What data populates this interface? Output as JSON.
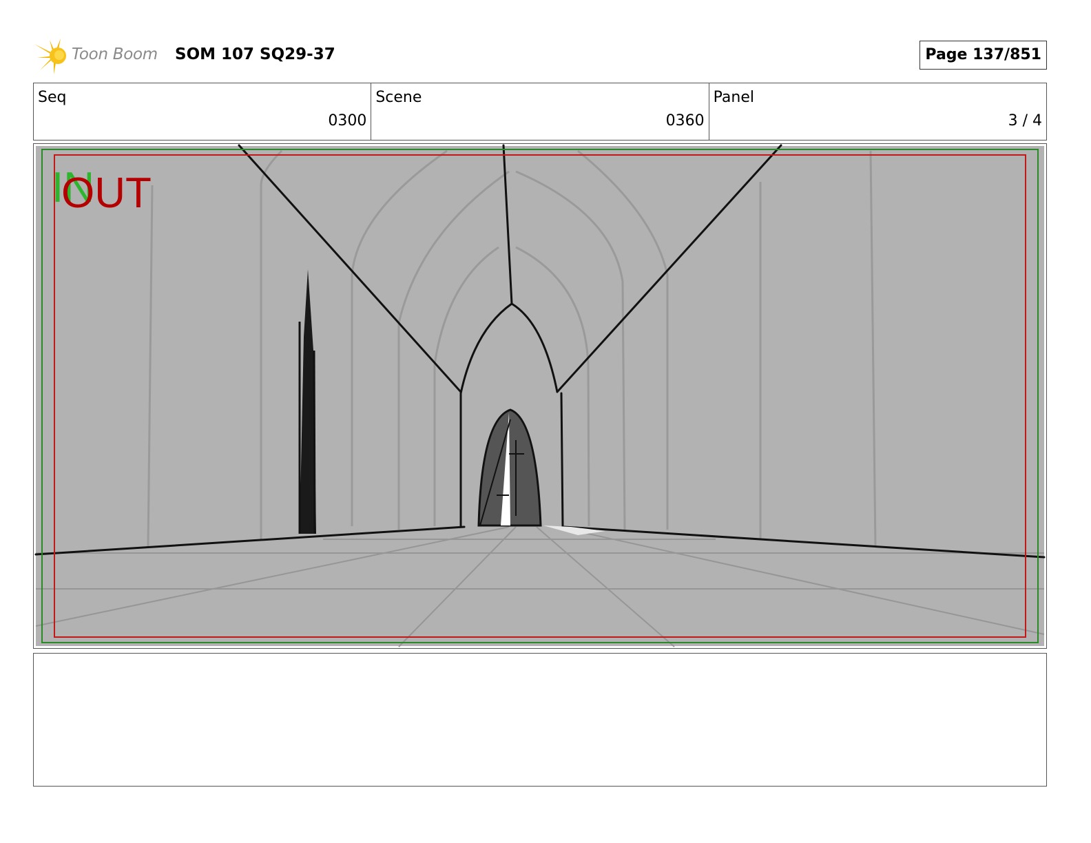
{
  "header": {
    "logo_text": "Toon Boom",
    "title": "SOM 107 SQ29-37",
    "page": "Page 137/851"
  },
  "info": {
    "seq_label": "Seq",
    "seq_value": "0300",
    "scene_label": "Scene",
    "scene_value": "0360",
    "panel_label": "Panel",
    "panel_value": "3 / 4"
  },
  "frame": {
    "in_label": "IN",
    "out_label": "OUT",
    "in_color": "#2db52d",
    "out_color": "#b40000"
  },
  "notes": ""
}
